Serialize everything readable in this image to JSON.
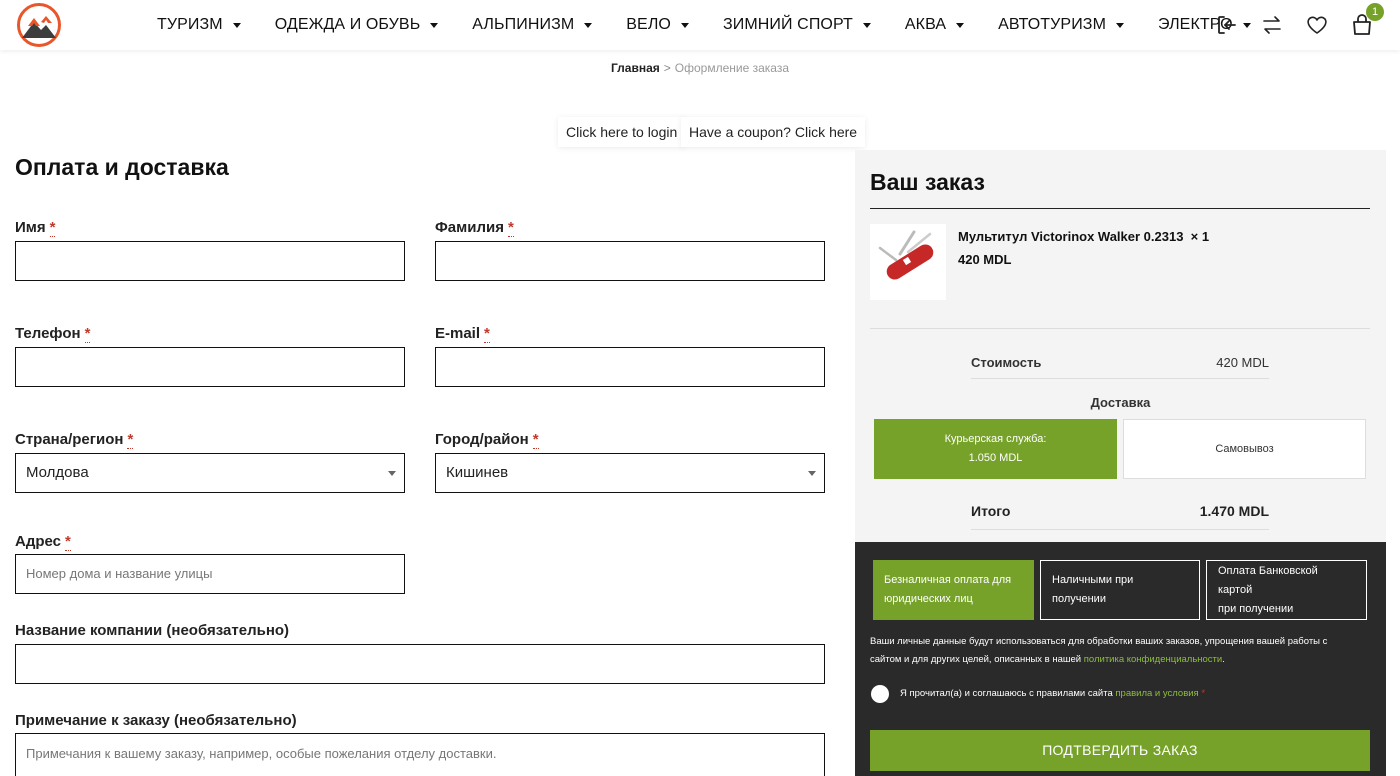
{
  "header": {
    "nav": [
      {
        "label": "ТУРИЗМ"
      },
      {
        "label": "ОДЕЖДА И ОБУВЬ"
      },
      {
        "label": "АЛЬПИНИЗМ"
      },
      {
        "label": "ВЕЛО"
      },
      {
        "label": "ЗИМНИЙ СПОРТ"
      },
      {
        "label": "АКВА"
      },
      {
        "label": "АВТОТУРИЗМ"
      },
      {
        "label": "ЭЛЕКТРО"
      }
    ],
    "icons": [
      "login-icon",
      "compare-icon",
      "wishlist-heart-icon",
      "cart-bag-icon"
    ],
    "cart_count": "1",
    "accent_color": "#76a22a",
    "logo_color": "#e8562a"
  },
  "breadcrumb": {
    "home": "Главная",
    "separator": ">",
    "current": "Оформление заказа"
  },
  "notices": {
    "login": "Click here to login",
    "coupon": "Have a coupon? Click here"
  },
  "billing": {
    "title": "Оплата и доставка",
    "required_mark": "*",
    "first_name_label": "Имя",
    "last_name_label": "Фамилия",
    "phone_label": "Телефон",
    "email_label": "E-mail",
    "country_label": "Страна/регион",
    "country_value": "Молдова",
    "city_label": "Город/район",
    "city_value": "Кишинев",
    "address_label": "Адрес",
    "address_placeholder": "Номер дома и название улицы",
    "company_label": "Название компании (необязательно)",
    "notes_label": "Примечание к заказу (необязательно)",
    "notes_placeholder": "Примечания к вашему заказу, например, особые пожелания отделу доставки."
  },
  "order": {
    "title": "Ваш заказ",
    "product_name": "Мультитул Victorinox Walker 0.2313",
    "product_qty": "× 1",
    "product_price": "420 MDL",
    "cost_label": "Стоимость",
    "cost_value": "420 MDL",
    "delivery_label": "Доставка",
    "shipping_courier_line1": "Курьерская служба:",
    "shipping_courier_line2": "1.050 MDL",
    "shipping_pickup": "Самовывоз",
    "total_label": "Итого",
    "total_value": "1.470 MDL"
  },
  "payment": {
    "option_business_line1": "Безналичная оплата для",
    "option_business_line2": "юридических лиц",
    "option_cash": "Наличными при получении",
    "option_card_line1": "Оплата Банковской картой",
    "option_card_line2": "при получении",
    "privacy_text_1": "Ваши личные данные будут использоваться для обработки ваших заказов, упрощения вашей работы с сайтом и для других целей, описанных в нашей",
    "privacy_link": "политика конфиденциальности",
    "privacy_text_2": ".",
    "terms_text": "Я прочитал(а) и соглашаюсь с правилами сайта",
    "terms_link": "правила и условия",
    "terms_star": "*",
    "confirm_button": "ПОДТВЕРДИТЬ ЗАКАЗ"
  }
}
